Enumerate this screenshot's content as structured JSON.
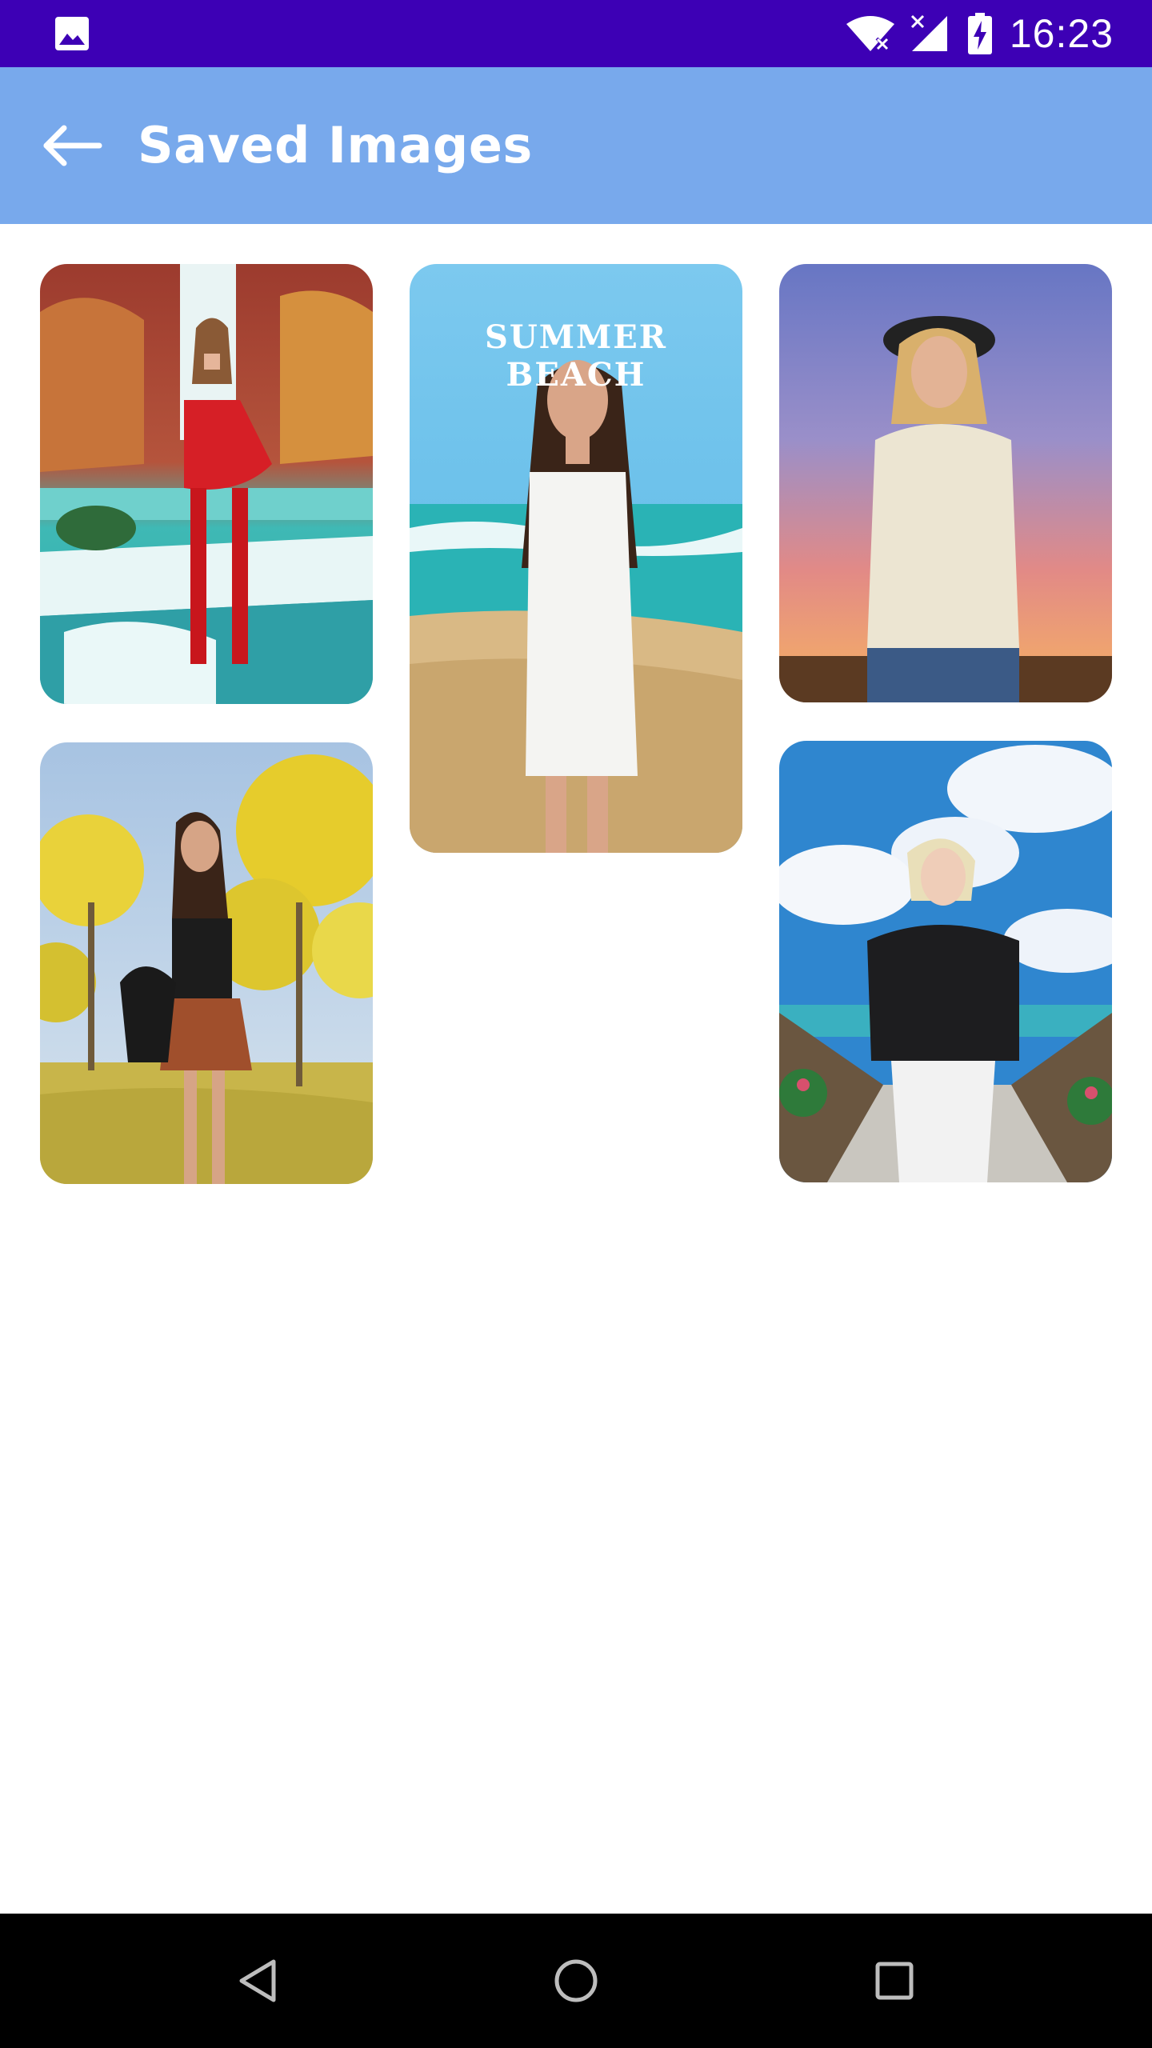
{
  "status_bar": {
    "time": "16:23",
    "left_icon": "image-icon",
    "right_icons": [
      "wifi-icon",
      "signal-icon",
      "battery-charging-icon"
    ],
    "background_color": "#3d00b5"
  },
  "app_bar": {
    "title": "Saved Images",
    "back_icon": "arrow-left-icon",
    "background_color": "#78a9ec"
  },
  "images": [
    {
      "scene": "waterfall",
      "caption": ""
    },
    {
      "scene": "beach",
      "caption": "SUMMER BEACH"
    },
    {
      "scene": "sunset",
      "caption": ""
    },
    {
      "scene": "yellow-trees",
      "caption": ""
    },
    {
      "scene": "clouds-bridge",
      "caption": ""
    }
  ],
  "nav_bar": {
    "icons": [
      "back-triangle-icon",
      "home-circle-icon",
      "recents-square-icon"
    ]
  }
}
